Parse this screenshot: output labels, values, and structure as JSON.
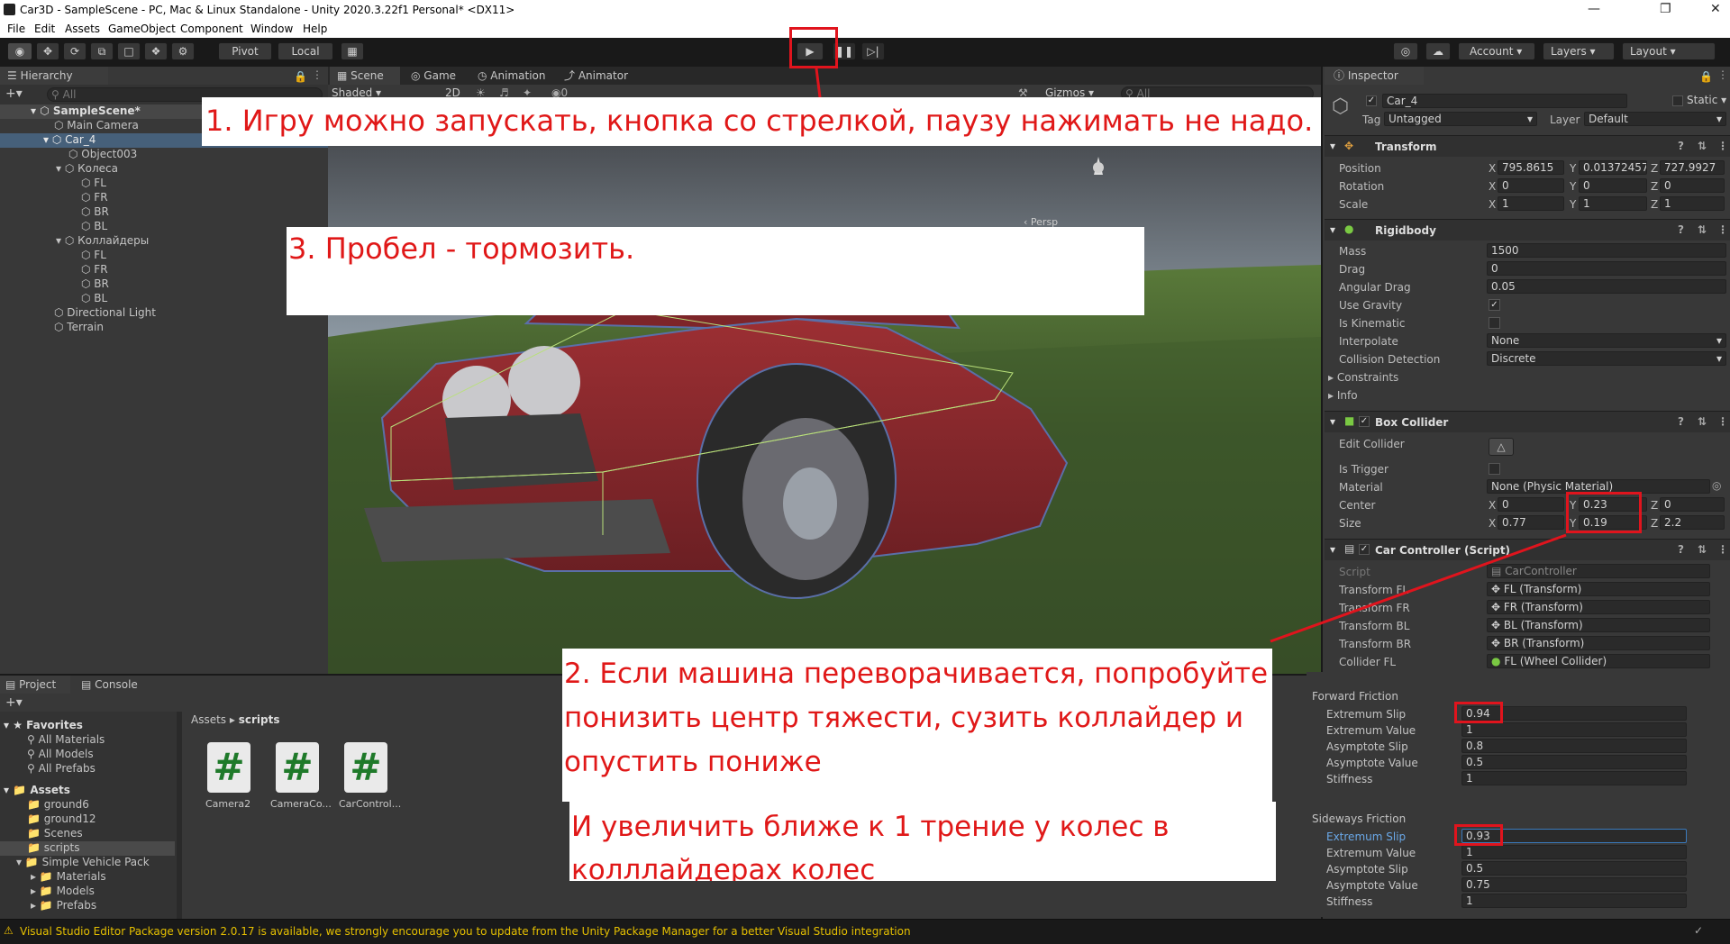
{
  "window": {
    "title": "Car3D - SampleScene - PC, Mac & Linux Standalone - Unity 2020.3.22f1 Personal* <DX11>"
  },
  "menu": [
    "File",
    "Edit",
    "Assets",
    "GameObject",
    "Component",
    "Window",
    "Help"
  ],
  "toolbar": {
    "pivot": "Pivot",
    "local": "Local",
    "account": "Account",
    "layers": "Layers",
    "layout": "Layout"
  },
  "hierarchy": {
    "tab": "Hierarchy",
    "search_placeholder": "All",
    "items": [
      "SampleScene*",
      "Main Camera",
      "Car_4",
      "Object003",
      "Колеса",
      "FL",
      "FR",
      "BR",
      "BL",
      "Коллайдеры",
      "FL",
      "FR",
      "BR",
      "BL",
      "Directional Light",
      "Terrain"
    ]
  },
  "scene": {
    "tabs": [
      "Scene",
      "Game",
      "Animation",
      "Animator"
    ],
    "shading": "Shaded",
    "mode": "2D",
    "hidden_count": "0",
    "gizmos": "Gizmos",
    "search_placeholder": "All",
    "persp": "Persp"
  },
  "inspector": {
    "tab": "Inspector",
    "object_name": "Car_4",
    "static": "Static",
    "tag_label": "Tag",
    "tag": "Untagged",
    "layer_label": "Layer",
    "layer": "Default",
    "transform": {
      "title": "Transform",
      "position_label": "Position",
      "position": [
        "795.8615",
        "0.01372457",
        "727.9927"
      ],
      "rotation_label": "Rotation",
      "rotation": [
        "0",
        "0",
        "0"
      ],
      "scale_label": "Scale",
      "scale": [
        "1",
        "1",
        "1"
      ]
    },
    "rigidbody": {
      "title": "Rigidbody",
      "mass_label": "Mass",
      "mass": "1500",
      "drag_label": "Drag",
      "drag": "0",
      "angular_drag_label": "Angular Drag",
      "angular_drag": "0.05",
      "use_gravity_label": "Use Gravity",
      "use_gravity": true,
      "is_kinematic_label": "Is Kinematic",
      "is_kinematic": false,
      "interpolate_label": "Interpolate",
      "interpolate": "None",
      "collision_label": "Collision Detection",
      "collision": "Discrete",
      "constraints_label": "Constraints",
      "info_label": "Info"
    },
    "box_collider": {
      "title": "Box Collider",
      "edit_collider_label": "Edit Collider",
      "is_trigger_label": "Is Trigger",
      "material_label": "Material",
      "material": "None (Physic Material)",
      "center_label": "Center",
      "center": [
        "0",
        "0.23",
        "0"
      ],
      "size_label": "Size",
      "size": [
        "0.77",
        "0.19",
        "2.2"
      ]
    },
    "car_controller": {
      "title": "Car Controller (Script)",
      "script_label": "Script",
      "script": "CarController",
      "rows": [
        {
          "label": "Transform FL",
          "value": "FL (Transform)"
        },
        {
          "label": "Transform FR",
          "value": "FR (Transform)"
        },
        {
          "label": "Transform BL",
          "value": "BL (Transform)"
        },
        {
          "label": "Transform BR",
          "value": "BR (Transform)"
        },
        {
          "label": "Collider FL",
          "value": "FL (Wheel Collider)"
        }
      ]
    },
    "wheel_friction": {
      "forward_title": "Forward Friction",
      "forward": [
        {
          "label": "Extremum Slip",
          "value": "0.94"
        },
        {
          "label": "Extremum Value",
          "value": "1"
        },
        {
          "label": "Asymptote Slip",
          "value": "0.8"
        },
        {
          "label": "Asymptote Value",
          "value": "0.5"
        },
        {
          "label": "Stiffness",
          "value": "1"
        }
      ],
      "sideways_title": "Sideways Friction",
      "sideways": [
        {
          "label": "Extremum Slip",
          "value": "0.93"
        },
        {
          "label": "Extremum Value",
          "value": "1"
        },
        {
          "label": "Asymptote Slip",
          "value": "0.5"
        },
        {
          "label": "Asymptote Value",
          "value": "0.75"
        },
        {
          "label": "Stiffness",
          "value": "1"
        }
      ]
    }
  },
  "project": {
    "tabs": [
      "Project",
      "Console"
    ],
    "favorites": "Favorites",
    "favorite_items": [
      "All Materials",
      "All Models",
      "All Prefabs"
    ],
    "assets": "Assets",
    "asset_folders": [
      "ground6",
      "ground12",
      "Scenes",
      "scripts",
      "Simple Vehicle Pack",
      "Materials",
      "Models",
      "Prefabs"
    ],
    "breadcrumb": [
      "Assets",
      "scripts"
    ],
    "files": [
      "Camera2",
      "CameraCo...",
      "CarControl..."
    ]
  },
  "status": {
    "message": "Visual Studio Editor Package version 2.0.17 is available, we strongly encourage you to update from the Unity Package Manager for a better Visual Studio integration"
  },
  "annotations": {
    "note1": "1. Игру можно запускать, кнопка со стрелкой, паузу нажимать не надо.",
    "note2": "2. Если машина переворачивается, попробуйте понизить центр тяжести, сузить коллайдер и опустить пониже",
    "note2b": "И увеличить ближе к 1 трение у колес в колллайдерах колес",
    "note3": "3. Пробел - тормозить."
  },
  "colors": {
    "annotation_red": "#e01818",
    "editor_bg": "#282828",
    "panel_bg": "#383838",
    "selection": "#2c5d87"
  }
}
